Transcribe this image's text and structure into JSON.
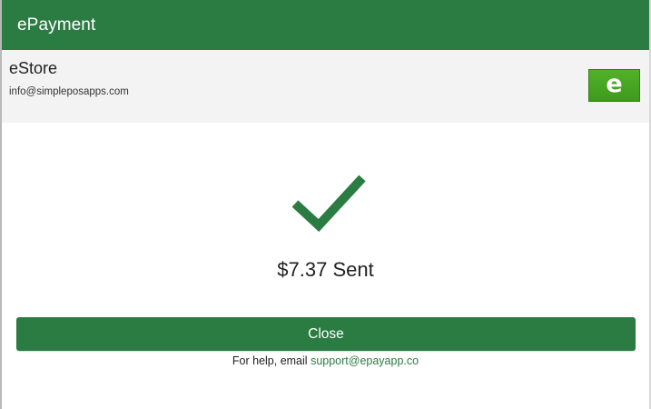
{
  "app": {
    "title": "ePayment"
  },
  "merchant": {
    "name": "eStore",
    "email": "info@simpleposapps.com",
    "logo_letter": "e"
  },
  "status": {
    "icon": "checkmark-icon",
    "message": "$7.37 Sent"
  },
  "actions": {
    "close_label": "Close"
  },
  "help": {
    "prefix": "For help, email",
    "email": "support@epayapp.co"
  },
  "colors": {
    "primary": "#2b7c42",
    "logo_green": "#4aa823",
    "header_bg": "#f3f3f3"
  }
}
